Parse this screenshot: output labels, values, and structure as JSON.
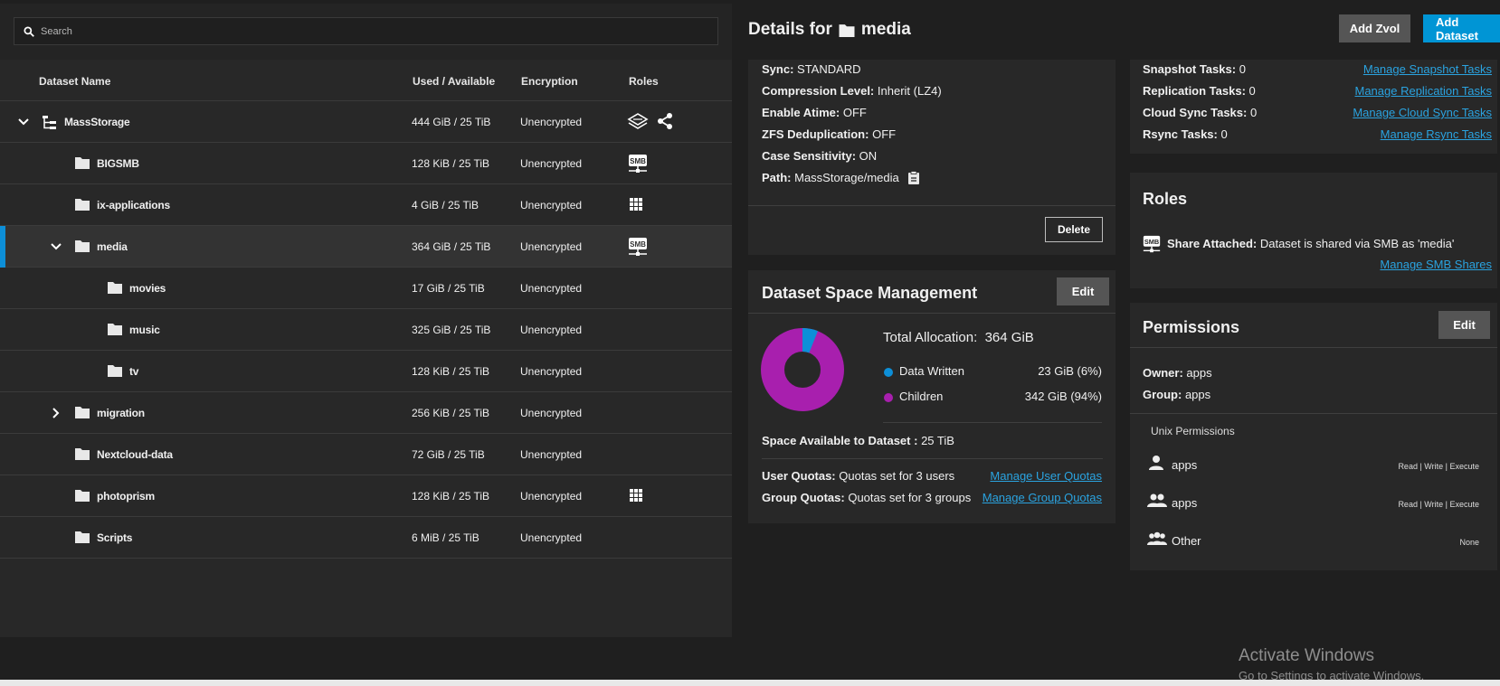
{
  "search": {
    "placeholder": "Search"
  },
  "tree": {
    "columns": {
      "name": "Dataset Name",
      "used": "Used / Available",
      "encryption": "Encryption",
      "roles": "Roles"
    },
    "rows": [
      {
        "name": "MassStorage",
        "used": "444 GiB / 25 TiB",
        "encryption": "Unencrypted"
      },
      {
        "name": "BIGSMB",
        "used": "128 KiB / 25 TiB",
        "encryption": "Unencrypted"
      },
      {
        "name": "ix-applications",
        "used": "4 GiB / 25 TiB",
        "encryption": "Unencrypted"
      },
      {
        "name": "media",
        "used": "364 GiB / 25 TiB",
        "encryption": "Unencrypted"
      },
      {
        "name": "movies",
        "used": "17 GiB / 25 TiB",
        "encryption": "Unencrypted"
      },
      {
        "name": "music",
        "used": "325 GiB / 25 TiB",
        "encryption": "Unencrypted"
      },
      {
        "name": "tv",
        "used": "128 KiB / 25 TiB",
        "encryption": "Unencrypted"
      },
      {
        "name": "migration",
        "used": "256 KiB / 25 TiB",
        "encryption": "Unencrypted"
      },
      {
        "name": "Nextcloud-data",
        "used": "72 GiB / 25 TiB",
        "encryption": "Unencrypted"
      },
      {
        "name": "photoprism",
        "used": "128 KiB / 25 TiB",
        "encryption": "Unencrypted"
      },
      {
        "name": "Scripts",
        "used": "6 MiB / 25 TiB",
        "encryption": "Unencrypted"
      }
    ],
    "smb_badge": "SMB"
  },
  "details": {
    "title_prefix": "Details for",
    "title_name": "media",
    "add_zvol": "Add Zvol",
    "add_dataset": "Add Dataset"
  },
  "info": {
    "sync_label": "Sync:",
    "sync_value": "STANDARD",
    "compression_label": "Compression Level:",
    "compression_value": "Inherit (LZ4)",
    "atime_label": "Enable Atime:",
    "atime_value": "OFF",
    "dedup_label": "ZFS Deduplication:",
    "dedup_value": "OFF",
    "case_label": "Case Sensitivity:",
    "case_value": "ON",
    "path_label": "Path:",
    "path_value": "MassStorage/media",
    "delete": "Delete"
  },
  "tasks": {
    "snapshot_label": "Snapshot Tasks:",
    "snapshot_value": "0",
    "snapshot_link": "Manage Snapshot Tasks",
    "replication_label": "Replication Tasks:",
    "replication_value": "0",
    "replication_link": "Manage Replication Tasks",
    "cloud_label": "Cloud Sync Tasks:",
    "cloud_value": "0",
    "cloud_link": "Manage Cloud Sync Tasks",
    "rsync_label": "Rsync Tasks:",
    "rsync_value": "0",
    "rsync_link": "Manage Rsync Tasks"
  },
  "space": {
    "title": "Dataset Space Management",
    "edit": "Edit",
    "total_label": "Total Allocation:",
    "total_value": "364 GiB",
    "data_written_label": "Data Written",
    "data_written_value": "23 GiB (6%)",
    "children_label": "Children",
    "children_value": "342 GiB (94%)",
    "available_label": "Space Available to Dataset :",
    "available_value": "25 TiB",
    "user_quotas_label": "User Quotas:",
    "user_quotas_value": "Quotas set for 3 users",
    "user_quotas_link": "Manage User Quotas",
    "group_quotas_label": "Group Quotas:",
    "group_quotas_value": "Quotas set for 3 groups",
    "group_quotas_link": "Manage Group Quotas",
    "data_written_color": "#0d8fd8",
    "children_color": "#a81fae",
    "data_written_fraction": 0.06
  },
  "roles": {
    "title": "Roles",
    "badge": "SMB",
    "share_label": "Share Attached:",
    "share_value": "Dataset is shared via SMB as 'media'",
    "manage_link": "Manage SMB Shares"
  },
  "permissions": {
    "title": "Permissions",
    "edit": "Edit",
    "owner_label": "Owner:",
    "owner_value": "apps",
    "group_label": "Group:",
    "group_value": "apps",
    "unix_label": "Unix Permissions",
    "entries": [
      {
        "name": "apps",
        "access": "Read | Write | Execute"
      },
      {
        "name": "apps",
        "access": "Read | Write | Execute"
      },
      {
        "name": "Other",
        "access": "None"
      }
    ]
  },
  "watermark": {
    "title": "Activate Windows",
    "subtitle": "Go to Settings to activate Windows."
  }
}
